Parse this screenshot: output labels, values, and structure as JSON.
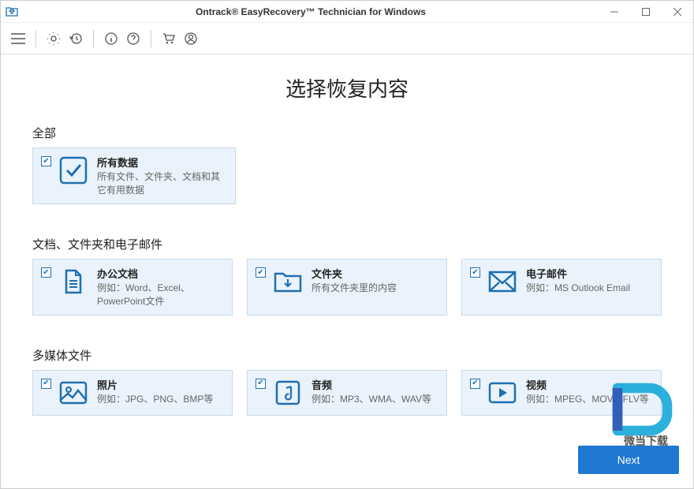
{
  "app": {
    "title": "Ontrack® EasyRecovery™ Technician for Windows"
  },
  "page": {
    "title": "选择恢复内容"
  },
  "sections": {
    "all": {
      "label": "全部"
    },
    "docs": {
      "label": "文档、文件夹和电子邮件"
    },
    "media": {
      "label": "多媒体文件"
    }
  },
  "cards": {
    "allData": {
      "title": "所有数据",
      "desc": "所有文件、文件夹、文档和其它有用数据"
    },
    "office": {
      "title": "办公文档",
      "desc": "例如：Word、Excel、PowerPoint文件"
    },
    "folder": {
      "title": "文件夹",
      "desc": "所有文件夹里的内容"
    },
    "email": {
      "title": "电子邮件",
      "desc": "例如：MS Outlook Email"
    },
    "photo": {
      "title": "照片",
      "desc": "例如：JPG、PNG、BMP等"
    },
    "audio": {
      "title": "音频",
      "desc": "例如：MP3、WMA、WAV等"
    },
    "video": {
      "title": "视频",
      "desc": "例如：MPEG、MOV、FLV等"
    }
  },
  "buttons": {
    "next": "Next"
  },
  "watermark": {
    "text": "微当下载"
  }
}
